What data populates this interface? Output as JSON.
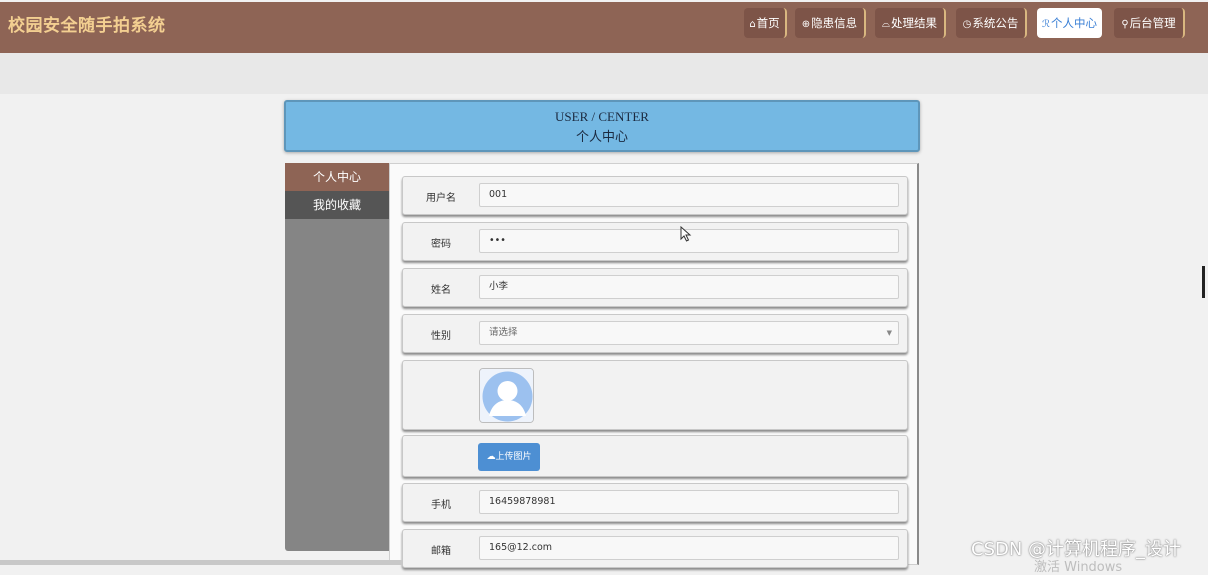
{
  "brand": "校园安全随手拍系统",
  "nav": [
    {
      "label": "首页",
      "icon": "⌂"
    },
    {
      "label": "隐患信息",
      "icon": "⊕"
    },
    {
      "label": "处理结果",
      "icon": "⌓"
    },
    {
      "label": "系统公告",
      "icon": "◷"
    },
    {
      "label": "个人中心",
      "icon": "ℛ"
    },
    {
      "label": "后台管理",
      "icon": "⚲"
    }
  ],
  "banner": {
    "en": "USER / CENTER",
    "cn": "个人中心"
  },
  "sidebar": {
    "items": [
      {
        "label": "个人中心"
      },
      {
        "label": "我的收藏"
      }
    ]
  },
  "form": {
    "username": {
      "label": "用户名",
      "value": "001"
    },
    "password": {
      "label": "密码",
      "value": "•••"
    },
    "name": {
      "label": "姓名",
      "value": "小李"
    },
    "gender": {
      "label": "性别",
      "placeholder": "请选择"
    },
    "upload_label": "上传图片",
    "phone": {
      "label": "手机",
      "value": "16459878981"
    },
    "email": {
      "label": "邮箱",
      "value": "165@12.com"
    }
  },
  "watermark": "CSDN @计算机程序_设计",
  "os_activation": "激活 Windows",
  "colors": {
    "topbar": "#8e6455",
    "brand": "#f3cf91",
    "banner": "#74b8e3",
    "accent": "#4d8fd3"
  }
}
